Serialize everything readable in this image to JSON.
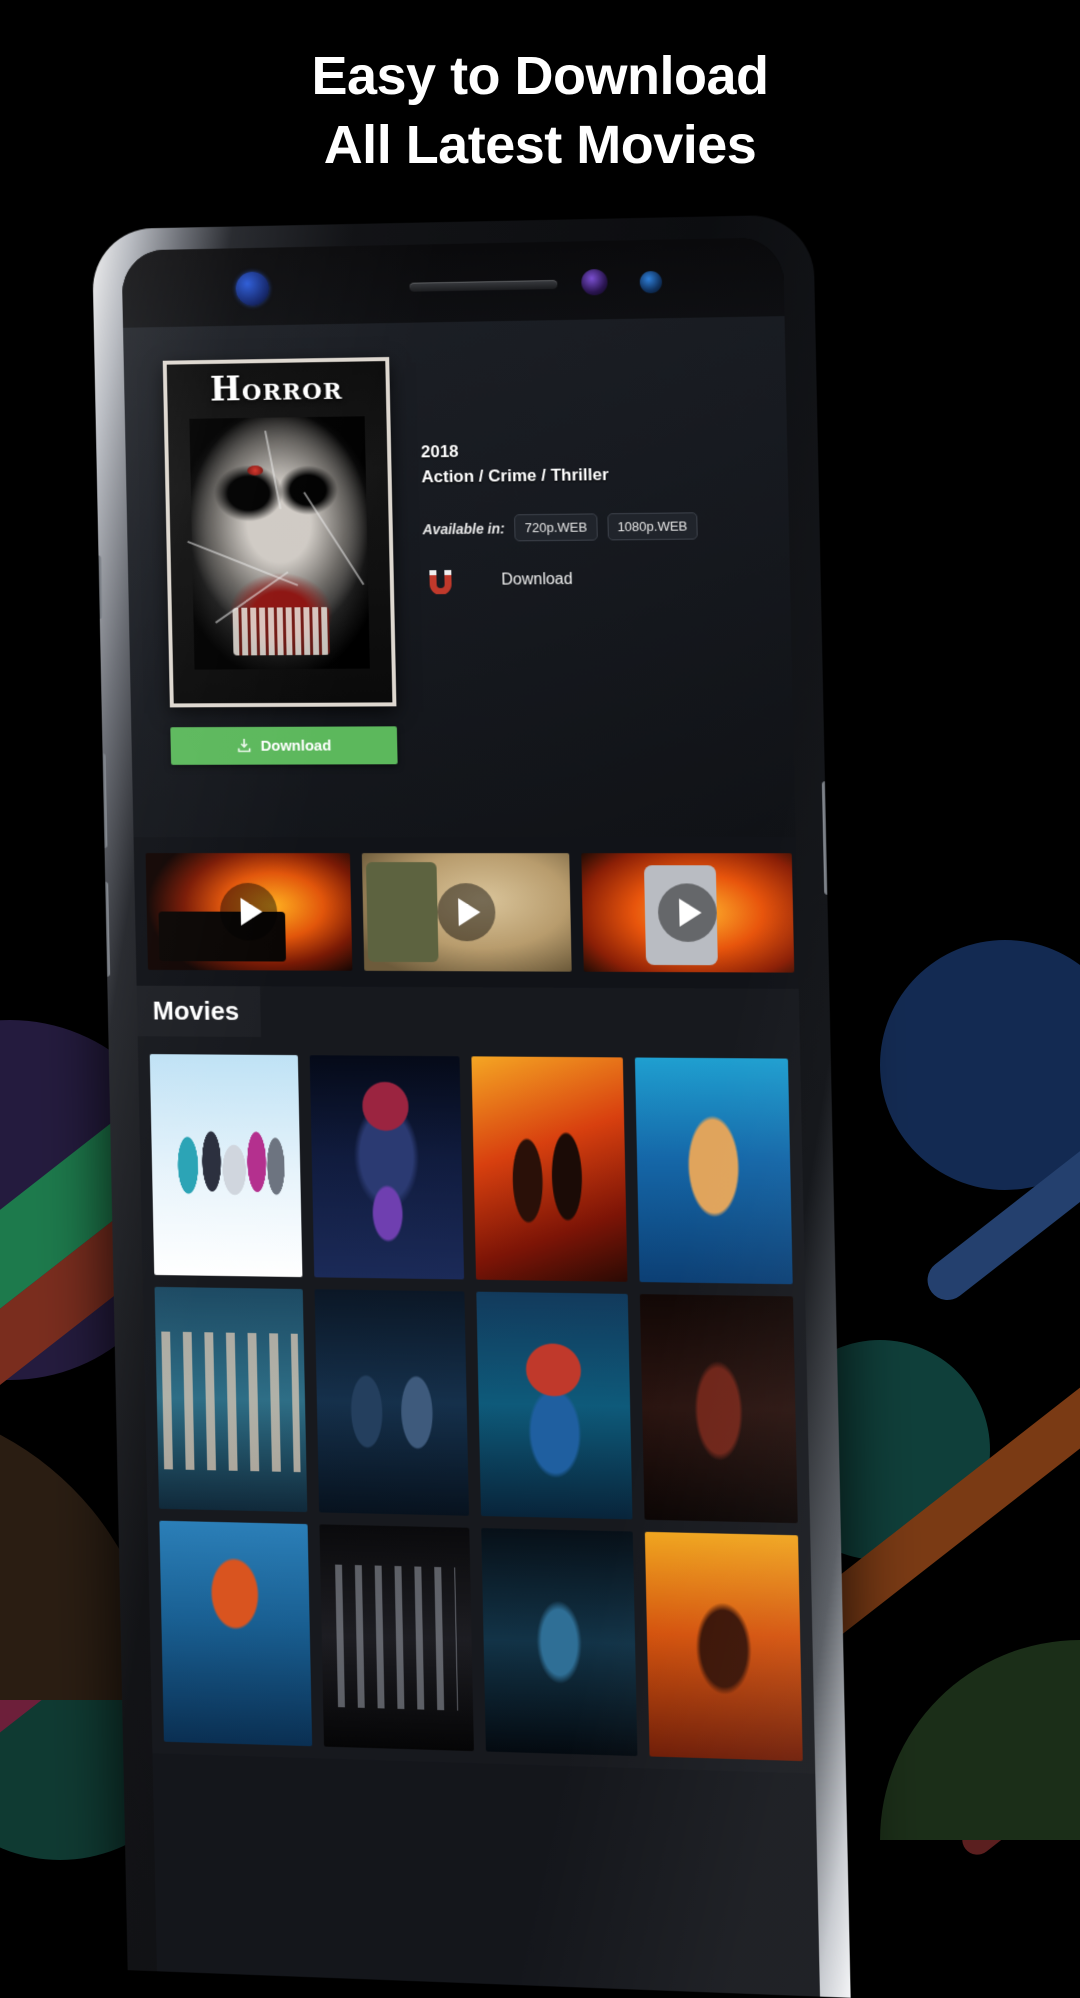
{
  "headline": {
    "line1": "Easy to Download",
    "line2": "All Latest Movies"
  },
  "colors": {
    "background": "#000000",
    "download_button": "#5cb85c",
    "screen_background": "#14161b",
    "detail_background": "#1d2026",
    "badge_border": "#3d424b",
    "text_primary": "#ffffff"
  },
  "phone": {
    "bezel": {
      "iris_sensor": "iris-scanner-icon",
      "earpiece": "earpiece-speaker",
      "front_camera": "front-camera-icon",
      "proximity_sensor": "proximity-sensor-icon"
    }
  },
  "app": {
    "detail": {
      "poster_title": "Horror",
      "year": "2018",
      "genres": "Action / Crime / Thriller",
      "available_label": "Available in:",
      "qualities": [
        "720p.WEB",
        "1080p.WEB"
      ],
      "magnet_label": "Download",
      "magnet_icon": "magnet-icon",
      "download_button": {
        "label": "Download",
        "icon": "download-tray-icon"
      }
    },
    "videos": [
      {
        "name": "trailer-explosion",
        "icon": "play-icon"
      },
      {
        "name": "trailer-soldier",
        "icon": "play-icon"
      },
      {
        "name": "trailer-firefighter",
        "icon": "play-icon"
      }
    ],
    "section": {
      "title": "Movies"
    },
    "grid": [
      {
        "name": "poster-frozen"
      },
      {
        "name": "poster-mary-poppins"
      },
      {
        "name": "poster-mortal-engines"
      },
      {
        "name": "poster-aquaman"
      },
      {
        "name": "poster-ensemble"
      },
      {
        "name": "poster-divergent"
      },
      {
        "name": "poster-captain-america"
      },
      {
        "name": "poster-dark-warrior"
      },
      {
        "name": "poster-brave"
      },
      {
        "name": "poster-thriller-cast"
      },
      {
        "name": "poster-underwater"
      },
      {
        "name": "poster-fire-action"
      }
    ]
  }
}
